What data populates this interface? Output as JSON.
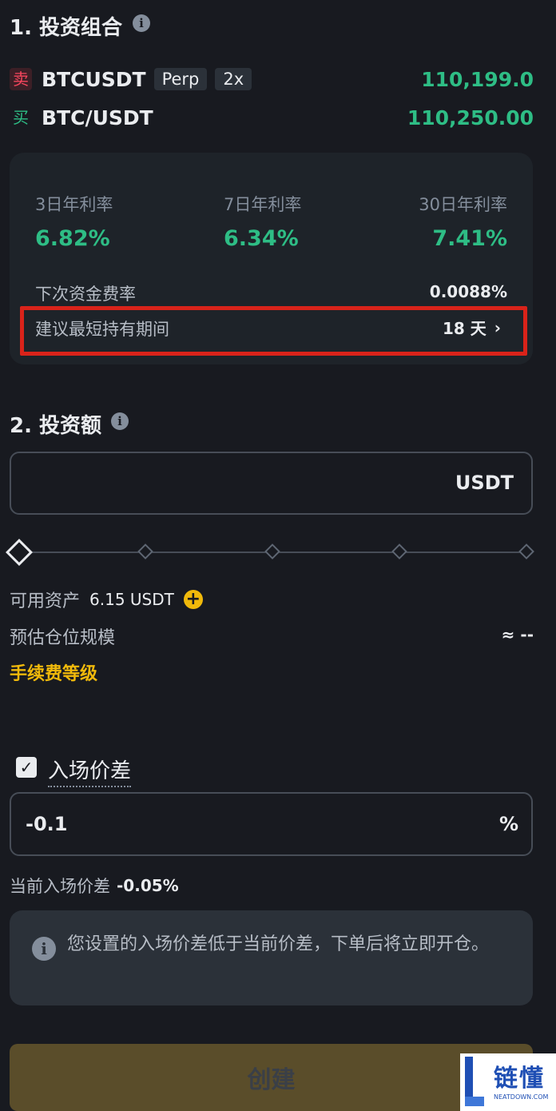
{
  "section1": {
    "title": "1. 投资组合",
    "pairs": [
      {
        "side": "卖",
        "symbol": "BTCUSDT",
        "tags": [
          "Perp",
          "2x"
        ],
        "price": "110,199.0"
      },
      {
        "side": "买",
        "symbol": "BTC/USDT",
        "price": "110,250.00"
      }
    ],
    "rates": [
      {
        "label": "3日年利率",
        "value": "6.82%"
      },
      {
        "label": "7日年利率",
        "value": "6.34%"
      },
      {
        "label": "30日年利率",
        "value": "7.41%"
      }
    ],
    "next_funding_label": "下次资金费率",
    "next_funding_value": "0.0088%",
    "min_hold_label": "建议最短持有期间",
    "min_hold_value": "18 天"
  },
  "section2": {
    "title": "2. 投资额",
    "amount_value": "",
    "currency": "USDT",
    "slider_level_percent": 0,
    "available_label": "可用资产",
    "available_value": "6.15 USDT",
    "est_position_label": "预估仓位规模",
    "est_position_value": "≈ --",
    "fee_level_link": "手续费等级"
  },
  "entry": {
    "checkbox_checked": true,
    "label": "入场价差",
    "value": "-0.1",
    "unit": "%",
    "current_label": "当前入场价差",
    "current_value": "-0.05%",
    "notice": "您设置的入场价差低于当前价差，下单后将立即开仓。"
  },
  "create_button": "创建",
  "watermark": {
    "text": "链懂",
    "sub": "NEATDOWN.COM"
  },
  "colors": {
    "up": "#2ebd85",
    "down": "#f6465d",
    "accent": "#f0b90b",
    "highlight": "#d9231a"
  }
}
